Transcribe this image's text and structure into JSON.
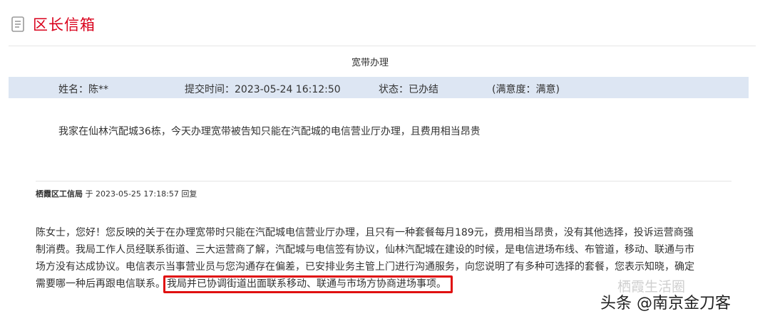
{
  "header": {
    "title": "区长信箱",
    "icon": "document-icon"
  },
  "letter": {
    "subject": "宽带办理",
    "name": "姓名：陈**",
    "submit_time": "提交时间：2023-05-24 16:12:50",
    "status": "状态：已办结",
    "satisfaction": "(满意度：满意)",
    "content": "我家在仙林汽配城36栋，今天办理宽带被告知只能在汽配城的电信营业厅办理，且费用相当昂贵"
  },
  "reply": {
    "department": "栖霞区工信局",
    "meta_suffix": " 于 2023-05-25 17:18:57 回复",
    "lines": [
      "陈女士，您好！您反映的关于在办理宽带时只能在汽配城电信营业厅办理，且只有一种套餐每月189元，费用相当昂贵，没有其他选择，投诉运营商强",
      "制消费。我局工作人员经联系街道、三大运营商了解，汽配城与电信签有协议，仙林汽配城在建设的时候，是电信进场布线、布管道，移动、联通与市",
      "场方没有达成协议。电信表示当事营业员与您沟通存在偏差，已安排业务主管上门进行沟通服务，向您说明了有多种可选择的套餐，您表示知晓，确定",
      "需要哪一种后再跟电信联系。"
    ],
    "highlight": "我局并已协调街道出面联系移动、联通与市场方协商进场事项。"
  },
  "watermark": {
    "text": "头条 @南京金刀客",
    "faint": "栖霞生活圈"
  },
  "colors": {
    "accent": "#d9001b",
    "info_bar": "#dde6f3",
    "highlight_border": "#e01010"
  }
}
